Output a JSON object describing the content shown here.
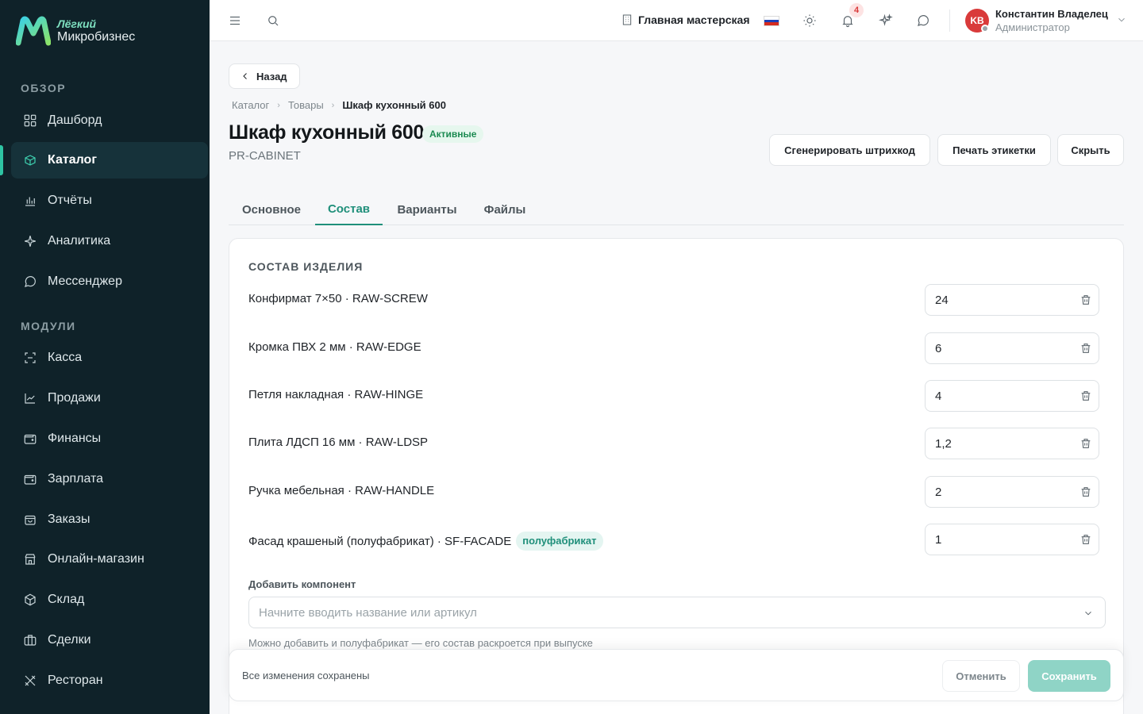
{
  "brand": {
    "top": "Лёгкий",
    "bottom": "Микробизнес"
  },
  "sidebar": {
    "section_overview": "ОБЗОР",
    "section_modules": "МОДУЛИ",
    "items": [
      {
        "label": "Дашборд",
        "icon": "grid-icon"
      },
      {
        "label": "Каталог",
        "icon": "catalog-icon",
        "active": true
      },
      {
        "label": "Отчёты",
        "icon": "bar-chart-icon"
      },
      {
        "label": "Аналитика",
        "icon": "sparkles-icon"
      },
      {
        "label": "Мессенджер",
        "icon": "chat-icon"
      },
      {
        "label": "Касса",
        "icon": "scan-icon"
      },
      {
        "label": "Продажи",
        "icon": "line-chart-icon"
      },
      {
        "label": "Финансы",
        "icon": "wallet-icon"
      },
      {
        "label": "Зарплата",
        "icon": "wallet-icon"
      },
      {
        "label": "Заказы",
        "icon": "bag-icon"
      },
      {
        "label": "Онлайн-магазин",
        "icon": "store-icon"
      },
      {
        "label": "Склад",
        "icon": "box-icon"
      },
      {
        "label": "Сделки",
        "icon": "briefcase-icon"
      },
      {
        "label": "Ресторан",
        "icon": "utensils-icon"
      }
    ]
  },
  "topbar": {
    "workshop": "Главная мастерская",
    "notifications_count": "4",
    "user_initials": "KB",
    "user_name": "Константин Владелец",
    "user_role": "Администратор"
  },
  "page": {
    "back_label": "Назад",
    "breadcrumb": [
      "Каталог",
      "Товары",
      "Шкаф кухонный 600"
    ],
    "title": "Шкаф кухонный 600",
    "status": "Активные",
    "sku": "PR-CABINET",
    "actions": [
      "Сгенерировать штрихкод",
      "Печать этикетки",
      "Скрыть"
    ]
  },
  "tabs": [
    "Основное",
    "Состав",
    "Варианты",
    "Файлы"
  ],
  "composition": {
    "title": "СОСТАВ ИЗДЕЛИЯ",
    "rows": [
      {
        "name": "Конфирмат 7×50 · RAW-SCREW",
        "qty": "24"
      },
      {
        "name": "Кромка ПВХ 2 мм · RAW-EDGE",
        "qty": "6"
      },
      {
        "name": "Петля накладная · RAW-HINGE",
        "qty": "4"
      },
      {
        "name": "Плита ЛДСП 16 мм · RAW-LDSP",
        "qty": "1,2"
      },
      {
        "name": "Ручка мебельная · RAW-HANDLE",
        "qty": "2"
      },
      {
        "name": "Фасад крашеный (полуфабрикат) · SF-FACADE",
        "qty": "1",
        "badge": "полуфабрикат"
      }
    ],
    "add_label": "Добавить компонент",
    "add_placeholder": "Начните вводить название или артикул",
    "add_hint": "Можно добавить и полуфабрикат — его состав раскроется при выпуске"
  },
  "savebar": {
    "status": "Все изменения сохранены",
    "cancel": "Отменить",
    "save": "Сохранить"
  },
  "colors": {
    "accent": "#1f8f7a",
    "sidebar_bg": "#0f2229",
    "save_disabled": "#8fd4c6",
    "status_green": "#1b8a51"
  }
}
